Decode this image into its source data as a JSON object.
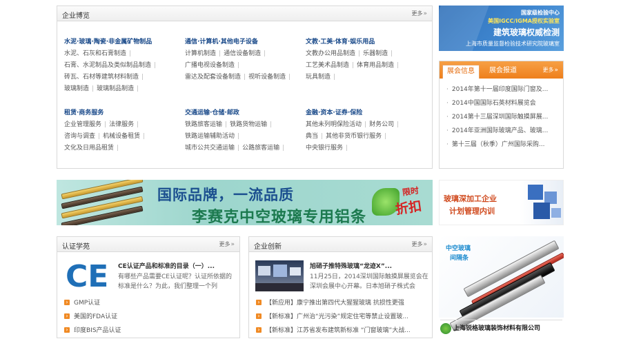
{
  "browse": {
    "title": "企业博览",
    "more": "更多",
    "categories": [
      {
        "title": "水泥·玻璃·陶瓷·非金属矿物制品",
        "rows": [
          [
            "水泥、石灰和石膏制造"
          ],
          [
            "石膏、水泥制品及类似制品制造"
          ],
          [
            "砖瓦、石材等建筑材料制造"
          ],
          [
            "玻璃制造",
            "玻璃制品制造"
          ]
        ]
      },
      {
        "title": "通信·计算机·其他电子设备",
        "rows": [
          [
            "计算机制造",
            "通信设备制造"
          ],
          [
            "广播电视设备制造"
          ],
          [
            "雷达及配套设备制造",
            "视听设备制造"
          ]
        ]
      },
      {
        "title": "文教·工美·体育·娱乐用品",
        "rows": [
          [
            "文教办公用品制造",
            "乐器制造"
          ],
          [
            "工艺美术品制造",
            "体育用品制造"
          ],
          [
            "玩具制造"
          ]
        ]
      },
      {
        "title": "租赁·商务服务",
        "rows": [
          [
            "企业管理服务",
            "法律服务"
          ],
          [
            "咨询与调查",
            "机械设备租赁"
          ],
          [
            "文化及日用品租赁"
          ]
        ]
      },
      {
        "title": "交通运输·仓储·邮政",
        "rows": [
          [
            "铁路旅客运输",
            "铁路货物运输"
          ],
          [
            "铁路运输辅助活动"
          ],
          [
            "城市公共交通运输",
            "公路旅客运输"
          ]
        ]
      },
      {
        "title": "金融·资本·证券·保险",
        "rows": [
          [
            "其他未列明保险活动",
            "财务公司"
          ],
          [
            "典当",
            "其他非货币银行服务"
          ],
          [
            "中央银行服务"
          ]
        ]
      }
    ]
  },
  "banner_top": {
    "line1": "国家级检验中心",
    "line2": "美国IGCC/IGMA授权实验室",
    "line3": "建筑玻璃权威检测",
    "line4": "上海市质量监督检验技术研究院玻璃室"
  },
  "expo": {
    "tab_active": "展会信息",
    "tab_inactive": "展会报道",
    "more": "更多",
    "items": [
      "2014年第十一届印度国际门窗及...",
      "2014中国国际石英材料展览会",
      "2014第十三届深圳国际触摸屏展...",
      "2014年亚洲国际玻璃产品、玻璃...",
      "第十三届（秋季）广州国际采购..."
    ]
  },
  "banner_mid": {
    "line1": "国际品牌，一流品质",
    "line2": "李赛克中空玻璃专用铝条",
    "badge_top": "限时",
    "badge_main": "折扣"
  },
  "banner_train": {
    "line1": "玻璃深加工企业",
    "line2": "计划管理内训"
  },
  "cert": {
    "title": "认证学苑",
    "more": "更多",
    "logo_text": "CE",
    "headline": "CE认证产品和标准的目录（一）...",
    "desc": "有哪些产品需要CE认证呢？认证所依据的标准是什么？为此，我们整理一个列",
    "links": [
      "GMP认证",
      "美国的FDA认证",
      "印度BIS产品认证"
    ]
  },
  "innov": {
    "title": "企业创新",
    "more": "更多",
    "headline": "旭硝子推特殊玻璃“龙迹Ⅹ”...",
    "desc": "11月25日，2014深圳国际触摸屏展览会在深圳会展中心开幕。日本旭硝子株式会",
    "links": [
      {
        "tag": "【新应用】",
        "text": "康宁推出第四代大猩猩玻璃 抗损性更强"
      },
      {
        "tag": "【新标准】",
        "text": "广州治“光污染”规定住宅等禁止设置玻..."
      },
      {
        "tag": "【新标准】",
        "text": "江苏省发布建筑新标准 “门窗玻璃”大战..."
      }
    ]
  },
  "product": {
    "label1": "中空玻璃",
    "label2": "间隔条",
    "company": "上海锐格玻璃装饰材料有限公司"
  }
}
